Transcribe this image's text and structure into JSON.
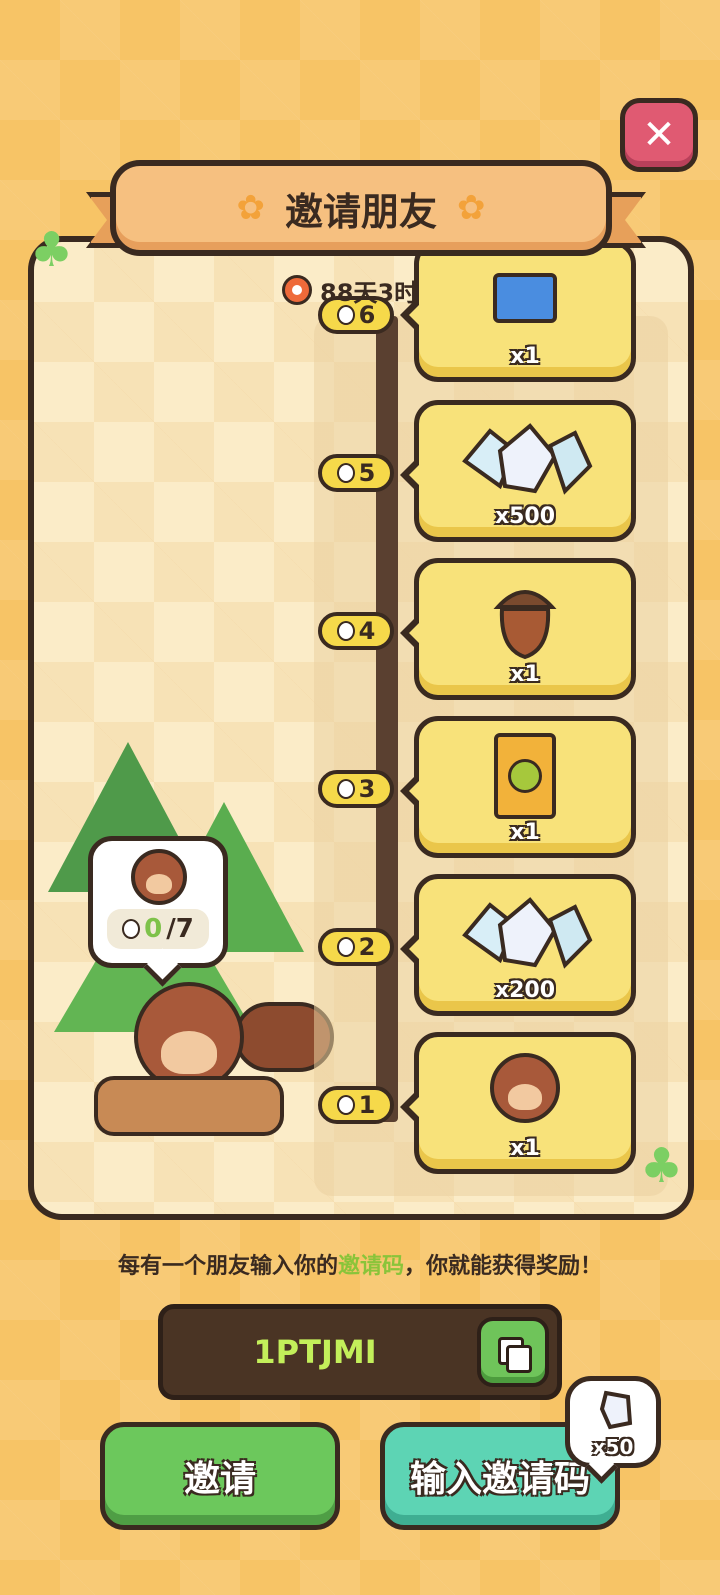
{
  "header": {
    "title": "邀请朋友",
    "timer": "88天3时"
  },
  "mascot": {
    "progress_current": "0",
    "progress_total": "/7"
  },
  "milestones": [
    {
      "level": "6",
      "reward_qty": "x1",
      "reward_icon": "ticket-icon"
    },
    {
      "level": "5",
      "reward_qty": "x500",
      "reward_icon": "crystal-shards-icon"
    },
    {
      "level": "4",
      "reward_qty": "x1",
      "reward_icon": "acorn-icon"
    },
    {
      "level": "3",
      "reward_qty": "x1",
      "reward_icon": "sticker-pack-icon"
    },
    {
      "level": "2",
      "reward_qty": "x200",
      "reward_icon": "crystal-shards-icon"
    },
    {
      "level": "1",
      "reward_qty": "x1",
      "reward_icon": "squirrel-costume-icon"
    }
  ],
  "hint": {
    "prefix": "每有一个朋友输入你的",
    "highlight": "邀请码",
    "suffix": "，你就能获得奖励！"
  },
  "invite_code": {
    "code": "1PTJMI"
  },
  "buttons": {
    "invite": "邀请",
    "enter_code": "输入邀请码"
  },
  "bonus": {
    "qty": "x50",
    "icon": "crystal-shard-icon"
  },
  "colors": {
    "accent_green": "#8ac43a",
    "code_text": "#c3ef5a",
    "panel_bg": "#fbecc8"
  }
}
